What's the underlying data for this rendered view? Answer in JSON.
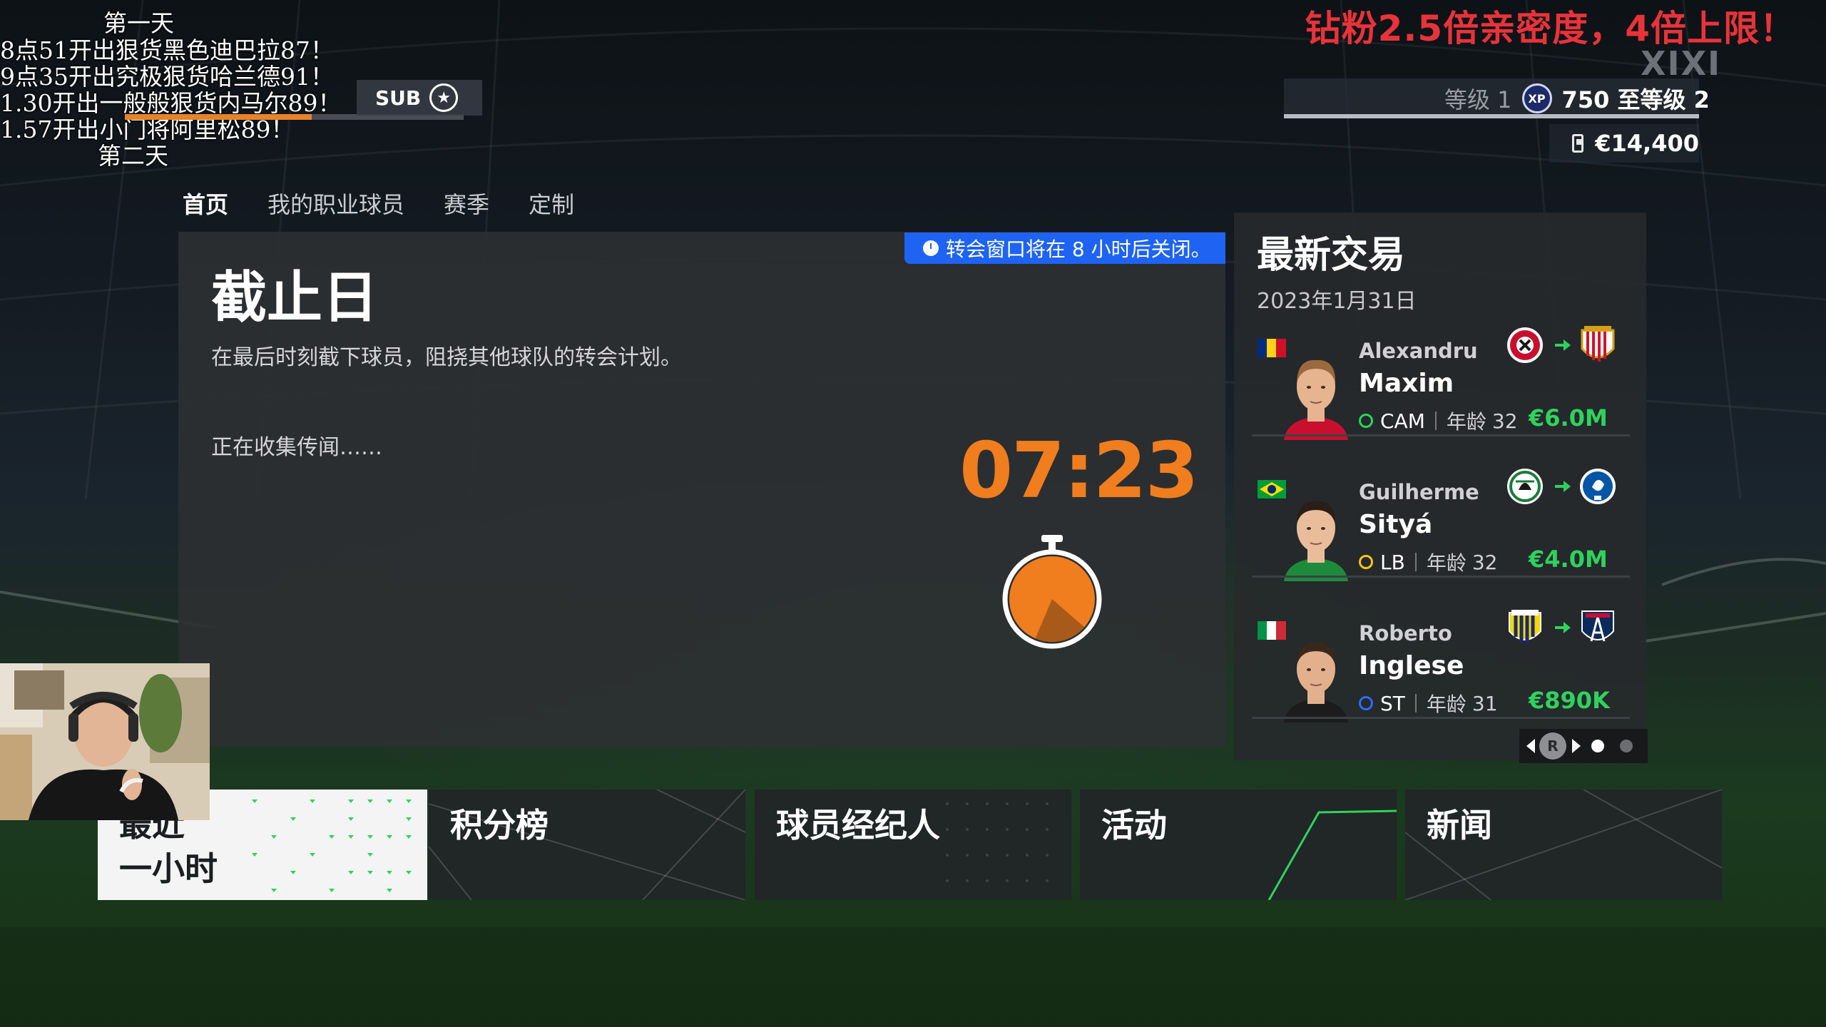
{
  "overlay": {
    "lines": [
      "第一天",
      "8点51开出狠货黑色迪巴拉87！",
      "9点35开出究极狠货哈兰德91！",
      "1.30开出一般般狠货内马尔89！",
      "1.57开出小门将阿里松89！",
      "第二天"
    ],
    "sub_label": "SUB",
    "promo": "钻粉2.5倍亲密度，4倍上限！",
    "streamer": "XIXI"
  },
  "header": {
    "level_label": "等级 1",
    "xp_icon_label": "XP",
    "xp_text": "750 至等级  2",
    "coins": "€14,400",
    "xp_progress": 0.0
  },
  "tabs": [
    {
      "label": "首页",
      "active": true
    },
    {
      "label": "我的职业球员",
      "active": false
    },
    {
      "label": "赛季",
      "active": false
    },
    {
      "label": "定制",
      "active": false
    }
  ],
  "deadline": {
    "notice": "转会窗口将在 8 小时后关闭。",
    "title": "截止日",
    "description": "在最后时刻截下球员，阻挠其他球队的转会计划。",
    "rumor_status": "正在收集传闻……",
    "countdown": "07:23",
    "stopwatch_fraction": 0.7
  },
  "transfers": {
    "title": "最新交易",
    "date": "2023年1月31日",
    "items": [
      {
        "first": "Alexandru",
        "last": "Maxim",
        "pos": "CAM",
        "age_label": "年龄",
        "age": "32",
        "fee": "€6.0M",
        "dot": "#2fd25e",
        "flag": [
          "#002b7f",
          "#fcd116",
          "#ce1126"
        ],
        "from_crest": "gaziantep",
        "to_crest": "almeria",
        "skin": "#e6b48f",
        "hair": "#9a6a3e",
        "shirt": "#c8102e"
      },
      {
        "first": "Guilherme",
        "last": "Sityá",
        "pos": "LB",
        "age_label": "年龄",
        "age": "32",
        "fee": "€4.0M",
        "dot": "#f5c518",
        "flag": [
          "#009b3a",
          "#fedf00",
          "#002776"
        ],
        "from_crest": "konyaspor",
        "to_crest": "gent",
        "skin": "#e9bd9c",
        "hair": "#2a1e17",
        "shirt": "#1e8b3c"
      },
      {
        "first": "Roberto",
        "last": "Inglese",
        "pos": "ST",
        "age_label": "年龄",
        "age": "31",
        "fee": "€890K",
        "dot": "#2f6bff",
        "flag": [
          "#009246",
          "#ffffff",
          "#ce2b37"
        ],
        "from_crest": "parma",
        "to_crest": "parisfc",
        "skin": "#e2b08c",
        "hair": "#3a281d",
        "shirt": "#1c1c1c"
      }
    ],
    "pager_button": "R"
  },
  "tiles": [
    {
      "label": "最近\n一小时"
    },
    {
      "label": "积分榜"
    },
    {
      "label": "球员经纪人"
    },
    {
      "label": "活动"
    },
    {
      "label": "新闻"
    }
  ],
  "colors": {
    "accent": "#f07d1e",
    "fee": "#2fd25e",
    "notice": "#1e63f2",
    "promo": "#e8333a"
  }
}
